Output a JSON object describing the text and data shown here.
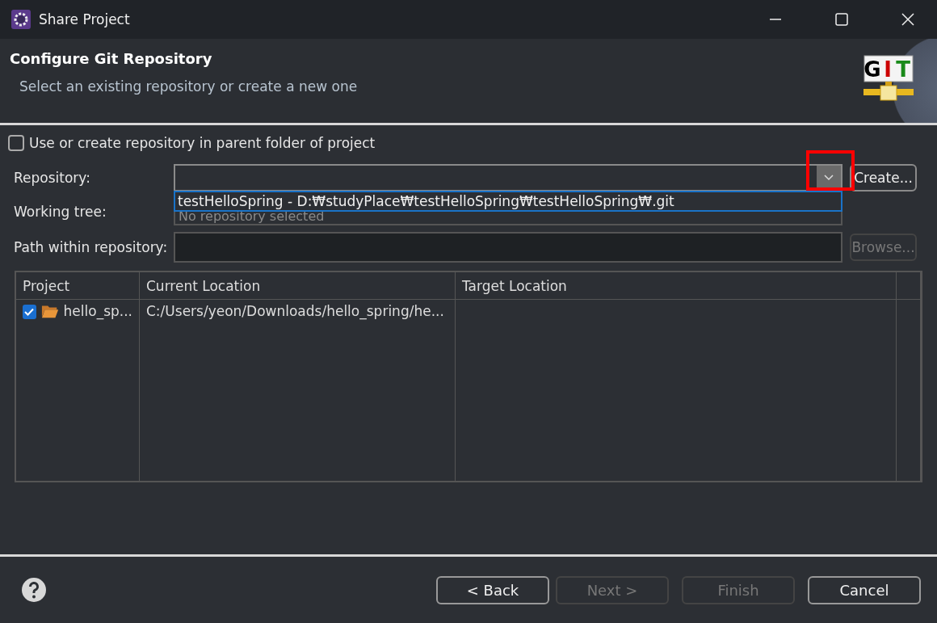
{
  "window": {
    "title": "Share Project"
  },
  "header": {
    "title": "Configure Git Repository",
    "subtitle": "Select an existing repository or create a new one",
    "logo_text": [
      {
        "letter": "G",
        "color": "#000000"
      },
      {
        "letter": "I",
        "color": "#cc0000"
      },
      {
        "letter": "T",
        "color": "#1a8a1a"
      }
    ]
  },
  "parent_folder_checkbox": {
    "label": "Use or create repository in parent folder of project",
    "checked": false
  },
  "repository": {
    "label": "Repository:",
    "create_button": {
      "label": "Create...",
      "disabled": false
    },
    "dropdown_open": true,
    "dropdown_items": [
      {
        "label": "testHelloSpring - D:₩studyPlace₩testHelloSpring₩testHelloSpring₩.git",
        "selected": true
      }
    ]
  },
  "working_tree": {
    "label": "Working tree:",
    "value": "No repository selected"
  },
  "path_within_repository": {
    "label": "Path within repository:",
    "browse_button": {
      "label": "Browse...",
      "disabled": true
    }
  },
  "table": {
    "columns": [
      "Project",
      "Current Location",
      "Target Location"
    ],
    "rows": [
      {
        "checked": true,
        "project": "hello_sp...",
        "current_location": "C:/Users/yeon/Downloads/hello_spring/he..."
      }
    ]
  },
  "buttons": [
    {
      "label": "< Back",
      "disabled": false
    },
    {
      "label": "Next >",
      "disabled": true
    },
    {
      "label": "Finish",
      "disabled": true
    },
    {
      "label": "Cancel",
      "disabled": false
    }
  ]
}
